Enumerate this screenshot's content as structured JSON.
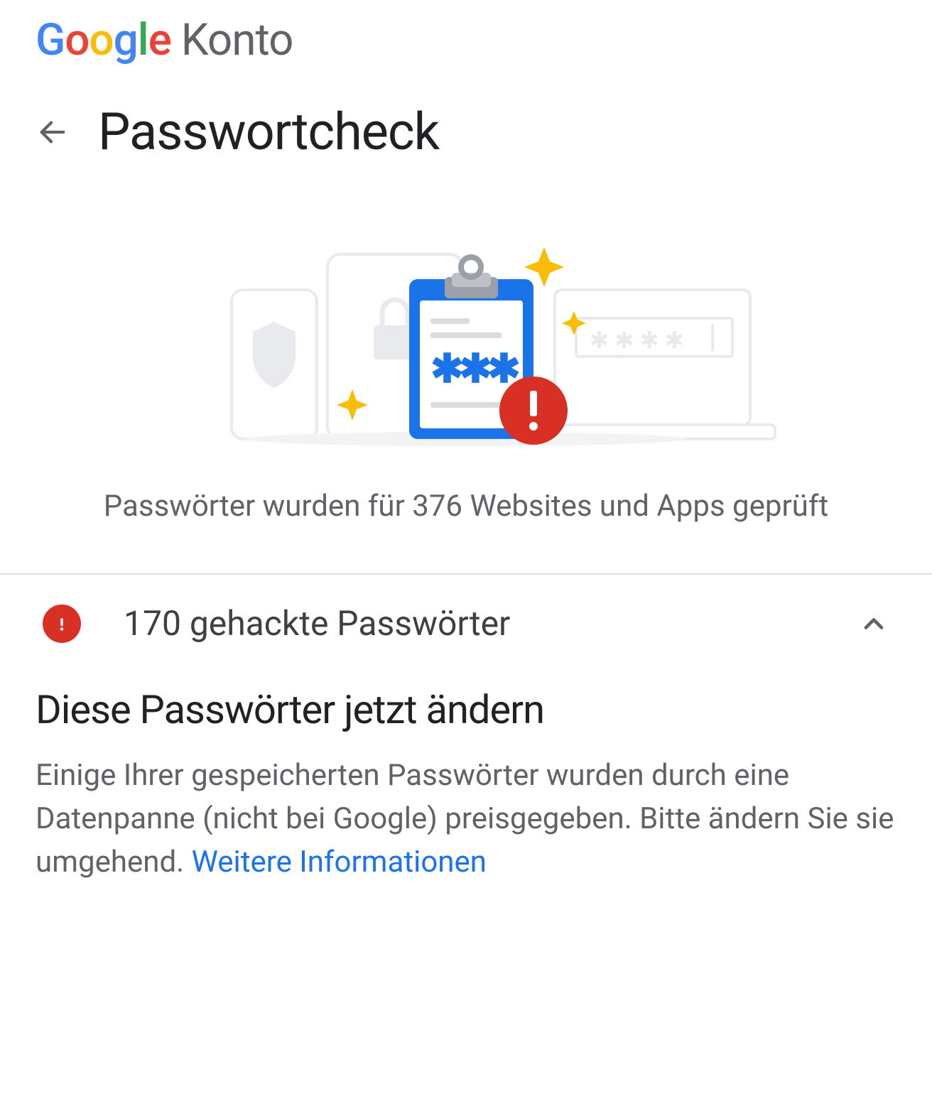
{
  "header": {
    "brand_product": "Konto"
  },
  "page": {
    "title": "Passwortcheck",
    "summary": "Passwörter wurden für 376 Websites und Apps geprüft"
  },
  "alert": {
    "title": "170 gehackte Passwörter"
  },
  "details": {
    "heading": "Diese Passwörter jetzt ändern",
    "body": "Einige Ihrer gespeicherten Passwörter wurden durch eine Datenpanne (nicht bei Google) preisgegeben. Bitte ändern Sie sie umgehend. ",
    "learn_more": "Weitere Informationen"
  }
}
